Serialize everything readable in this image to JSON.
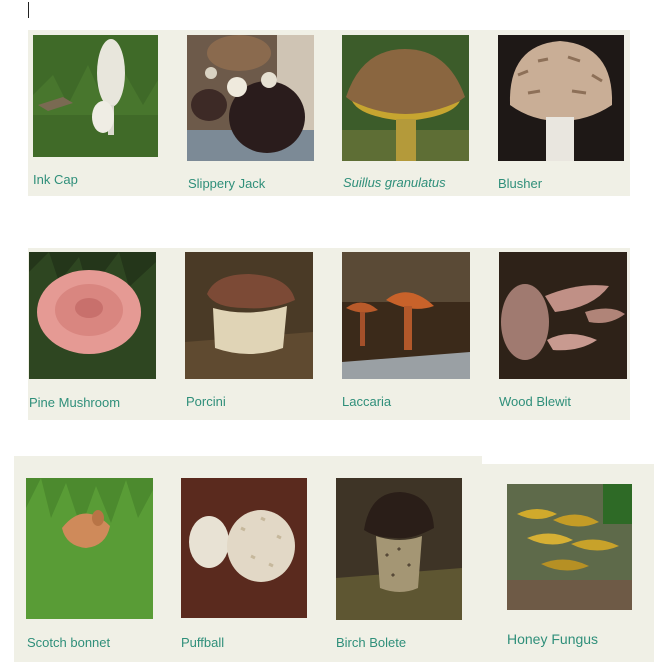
{
  "mushrooms": [
    {
      "name": "Ink Cap"
    },
    {
      "name": "Slippery Jack"
    },
    {
      "name": "Suillus granulatus"
    },
    {
      "name": "Blusher"
    },
    {
      "name": "Pine Mushroom"
    },
    {
      "name": "Porcini"
    },
    {
      "name": "Laccaria"
    },
    {
      "name": "Wood Blewit"
    },
    {
      "name": "Scotch bonnet"
    },
    {
      "name": "Puffball"
    },
    {
      "name": "Birch Bolete"
    },
    {
      "name": "Honey Fungus"
    }
  ],
  "colors": {
    "panel": "#f0f0e6",
    "label": "#2f8f7a"
  }
}
